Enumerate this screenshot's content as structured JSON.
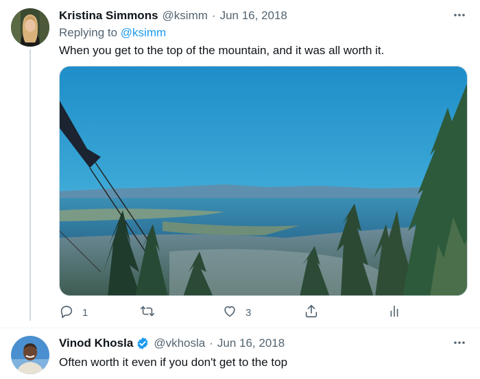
{
  "tweet1": {
    "name": "Kristina Simmons",
    "handle": "@ksimm",
    "separator": "·",
    "date": "Jun 16, 2018",
    "replying_prefix": "Replying to",
    "replying_handle": "@ksimm",
    "text": "When you get to the top of the mountain, and it was all worth it.",
    "reply_count": "1",
    "retweet_count": "",
    "like_count": "3"
  },
  "tweet2": {
    "name": "Vinod Khosla",
    "handle": "@vkhosla",
    "separator": "·",
    "date": "Jun 16, 2018",
    "text": "Often worth it even if you don't get to the top",
    "verified": true
  },
  "colors": {
    "accent": "#1d9bf0",
    "secondary_text": "#536471",
    "primary_text": "#0f1419",
    "thread_line": "#cfd9de"
  },
  "icons": {
    "reply": "reply-icon",
    "retweet": "retweet-icon",
    "like": "heart-icon",
    "share": "share-icon",
    "analytics": "analytics-icon",
    "more": "more-icon",
    "verified": "verified-badge-icon"
  }
}
